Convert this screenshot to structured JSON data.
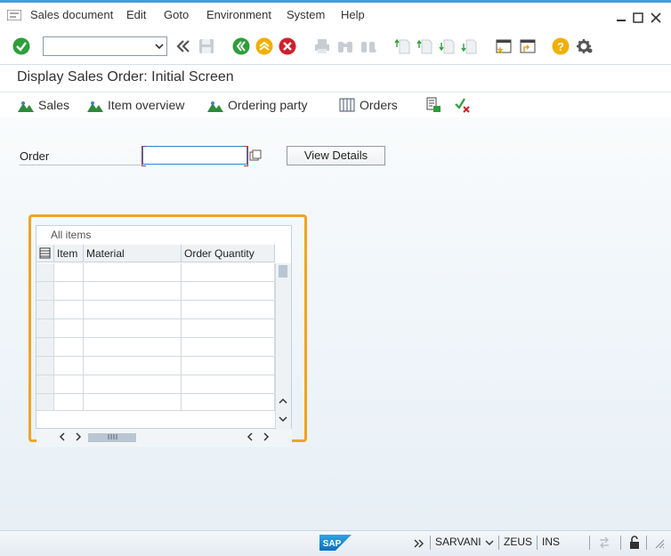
{
  "menubar": {
    "items": [
      "Sales document",
      "Edit",
      "Goto",
      "Environment",
      "System",
      "Help"
    ],
    "window_controls": [
      "minimize-icon",
      "maximize-icon",
      "close-icon"
    ]
  },
  "toolbar": {
    "command_field_value": "",
    "icons": [
      "enter-check-icon",
      "back-double-icon",
      "save-icon",
      "back-icon",
      "exit-icon",
      "cancel-icon",
      "print-icon",
      "find-icon",
      "find-next-icon",
      "first-page-icon",
      "previous-page-icon",
      "next-page-icon",
      "last-page-icon",
      "create-session-icon",
      "generate-shortcut-icon",
      "help-icon",
      "customize-layout-icon"
    ]
  },
  "title": "Display Sales Order: Initial Screen",
  "app_toolbar": {
    "sales": "Sales",
    "item_overview": "Item overview",
    "ordering_party": "Ordering party",
    "orders": "Orders"
  },
  "form": {
    "order_label": "Order",
    "order_value": "",
    "view_details": "View Details"
  },
  "items_table": {
    "title": "All items",
    "columns": [
      "Item",
      "Material",
      "Order Quantity"
    ],
    "rows": 8
  },
  "statusbar": {
    "user": "SARVANI",
    "system": "ZEUS",
    "mode": "INS"
  },
  "colors": {
    "accent": "#3f9fe0",
    "highlight": "#f0a422",
    "check_green": "#2e9e3a",
    "help_orange": "#f0b000",
    "exit_red": "#d0202a"
  }
}
